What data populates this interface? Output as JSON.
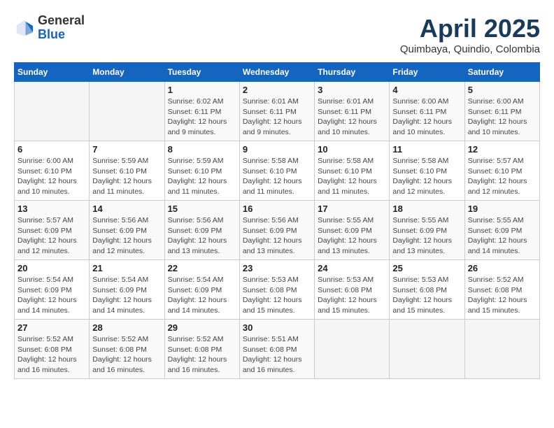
{
  "header": {
    "logo_general": "General",
    "logo_blue": "Blue",
    "month_title": "April 2025",
    "subtitle": "Quimbaya, Quindio, Colombia"
  },
  "weekdays": [
    "Sunday",
    "Monday",
    "Tuesday",
    "Wednesday",
    "Thursday",
    "Friday",
    "Saturday"
  ],
  "weeks": [
    [
      {
        "day": "",
        "sunrise": "",
        "sunset": "",
        "daylight": ""
      },
      {
        "day": "",
        "sunrise": "",
        "sunset": "",
        "daylight": ""
      },
      {
        "day": "1",
        "sunrise": "Sunrise: 6:02 AM",
        "sunset": "Sunset: 6:11 PM",
        "daylight": "Daylight: 12 hours and 9 minutes."
      },
      {
        "day": "2",
        "sunrise": "Sunrise: 6:01 AM",
        "sunset": "Sunset: 6:11 PM",
        "daylight": "Daylight: 12 hours and 9 minutes."
      },
      {
        "day": "3",
        "sunrise": "Sunrise: 6:01 AM",
        "sunset": "Sunset: 6:11 PM",
        "daylight": "Daylight: 12 hours and 10 minutes."
      },
      {
        "day": "4",
        "sunrise": "Sunrise: 6:00 AM",
        "sunset": "Sunset: 6:11 PM",
        "daylight": "Daylight: 12 hours and 10 minutes."
      },
      {
        "day": "5",
        "sunrise": "Sunrise: 6:00 AM",
        "sunset": "Sunset: 6:11 PM",
        "daylight": "Daylight: 12 hours and 10 minutes."
      }
    ],
    [
      {
        "day": "6",
        "sunrise": "Sunrise: 6:00 AM",
        "sunset": "Sunset: 6:10 PM",
        "daylight": "Daylight: 12 hours and 10 minutes."
      },
      {
        "day": "7",
        "sunrise": "Sunrise: 5:59 AM",
        "sunset": "Sunset: 6:10 PM",
        "daylight": "Daylight: 12 hours and 11 minutes."
      },
      {
        "day": "8",
        "sunrise": "Sunrise: 5:59 AM",
        "sunset": "Sunset: 6:10 PM",
        "daylight": "Daylight: 12 hours and 11 minutes."
      },
      {
        "day": "9",
        "sunrise": "Sunrise: 5:58 AM",
        "sunset": "Sunset: 6:10 PM",
        "daylight": "Daylight: 12 hours and 11 minutes."
      },
      {
        "day": "10",
        "sunrise": "Sunrise: 5:58 AM",
        "sunset": "Sunset: 6:10 PM",
        "daylight": "Daylight: 12 hours and 11 minutes."
      },
      {
        "day": "11",
        "sunrise": "Sunrise: 5:58 AM",
        "sunset": "Sunset: 6:10 PM",
        "daylight": "Daylight: 12 hours and 12 minutes."
      },
      {
        "day": "12",
        "sunrise": "Sunrise: 5:57 AM",
        "sunset": "Sunset: 6:10 PM",
        "daylight": "Daylight: 12 hours and 12 minutes."
      }
    ],
    [
      {
        "day": "13",
        "sunrise": "Sunrise: 5:57 AM",
        "sunset": "Sunset: 6:09 PM",
        "daylight": "Daylight: 12 hours and 12 minutes."
      },
      {
        "day": "14",
        "sunrise": "Sunrise: 5:56 AM",
        "sunset": "Sunset: 6:09 PM",
        "daylight": "Daylight: 12 hours and 12 minutes."
      },
      {
        "day": "15",
        "sunrise": "Sunrise: 5:56 AM",
        "sunset": "Sunset: 6:09 PM",
        "daylight": "Daylight: 12 hours and 13 minutes."
      },
      {
        "day": "16",
        "sunrise": "Sunrise: 5:56 AM",
        "sunset": "Sunset: 6:09 PM",
        "daylight": "Daylight: 12 hours and 13 minutes."
      },
      {
        "day": "17",
        "sunrise": "Sunrise: 5:55 AM",
        "sunset": "Sunset: 6:09 PM",
        "daylight": "Daylight: 12 hours and 13 minutes."
      },
      {
        "day": "18",
        "sunrise": "Sunrise: 5:55 AM",
        "sunset": "Sunset: 6:09 PM",
        "daylight": "Daylight: 12 hours and 13 minutes."
      },
      {
        "day": "19",
        "sunrise": "Sunrise: 5:55 AM",
        "sunset": "Sunset: 6:09 PM",
        "daylight": "Daylight: 12 hours and 14 minutes."
      }
    ],
    [
      {
        "day": "20",
        "sunrise": "Sunrise: 5:54 AM",
        "sunset": "Sunset: 6:09 PM",
        "daylight": "Daylight: 12 hours and 14 minutes."
      },
      {
        "day": "21",
        "sunrise": "Sunrise: 5:54 AM",
        "sunset": "Sunset: 6:09 PM",
        "daylight": "Daylight: 12 hours and 14 minutes."
      },
      {
        "day": "22",
        "sunrise": "Sunrise: 5:54 AM",
        "sunset": "Sunset: 6:09 PM",
        "daylight": "Daylight: 12 hours and 14 minutes."
      },
      {
        "day": "23",
        "sunrise": "Sunrise: 5:53 AM",
        "sunset": "Sunset: 6:08 PM",
        "daylight": "Daylight: 12 hours and 15 minutes."
      },
      {
        "day": "24",
        "sunrise": "Sunrise: 5:53 AM",
        "sunset": "Sunset: 6:08 PM",
        "daylight": "Daylight: 12 hours and 15 minutes."
      },
      {
        "day": "25",
        "sunrise": "Sunrise: 5:53 AM",
        "sunset": "Sunset: 6:08 PM",
        "daylight": "Daylight: 12 hours and 15 minutes."
      },
      {
        "day": "26",
        "sunrise": "Sunrise: 5:52 AM",
        "sunset": "Sunset: 6:08 PM",
        "daylight": "Daylight: 12 hours and 15 minutes."
      }
    ],
    [
      {
        "day": "27",
        "sunrise": "Sunrise: 5:52 AM",
        "sunset": "Sunset: 6:08 PM",
        "daylight": "Daylight: 12 hours and 16 minutes."
      },
      {
        "day": "28",
        "sunrise": "Sunrise: 5:52 AM",
        "sunset": "Sunset: 6:08 PM",
        "daylight": "Daylight: 12 hours and 16 minutes."
      },
      {
        "day": "29",
        "sunrise": "Sunrise: 5:52 AM",
        "sunset": "Sunset: 6:08 PM",
        "daylight": "Daylight: 12 hours and 16 minutes."
      },
      {
        "day": "30",
        "sunrise": "Sunrise: 5:51 AM",
        "sunset": "Sunset: 6:08 PM",
        "daylight": "Daylight: 12 hours and 16 minutes."
      },
      {
        "day": "",
        "sunrise": "",
        "sunset": "",
        "daylight": ""
      },
      {
        "day": "",
        "sunrise": "",
        "sunset": "",
        "daylight": ""
      },
      {
        "day": "",
        "sunrise": "",
        "sunset": "",
        "daylight": ""
      }
    ]
  ]
}
